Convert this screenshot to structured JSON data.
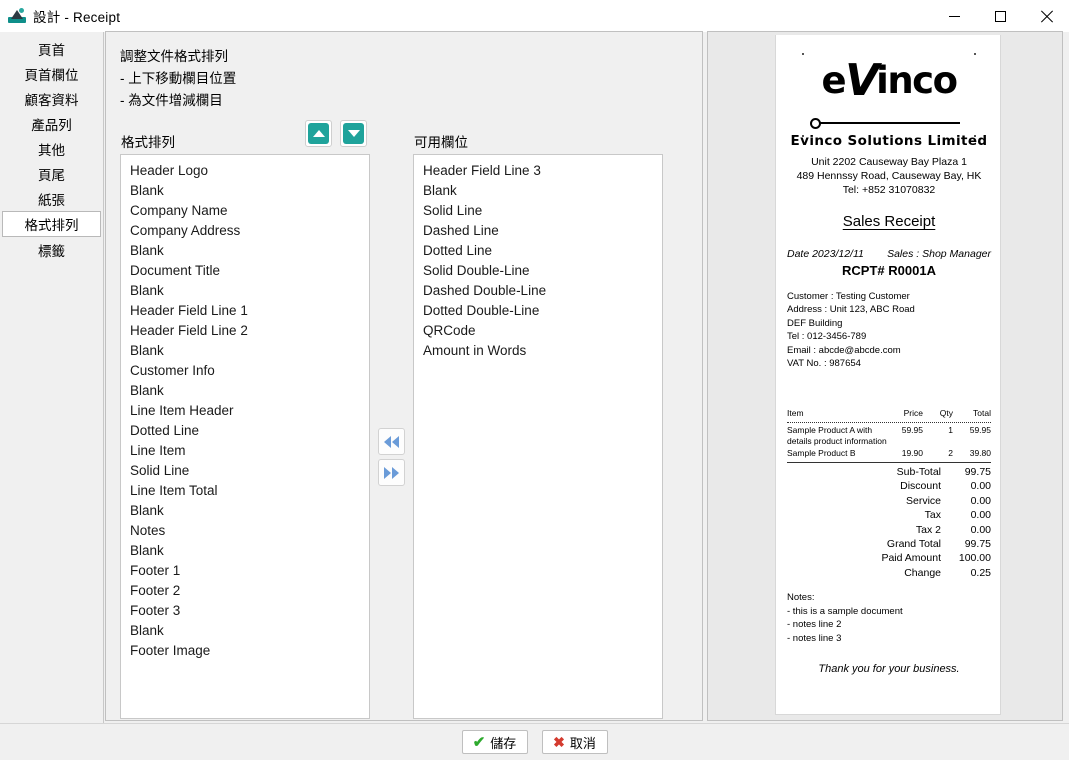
{
  "window": {
    "title": "設計 - Receipt",
    "icon": "app-logo-icon",
    "minimize_label": "—",
    "maximize_label": "□",
    "close_label": "✕"
  },
  "sidebar": {
    "items": [
      {
        "label": "頁首",
        "selected": false
      },
      {
        "label": "頁首欄位",
        "selected": false
      },
      {
        "label": "顧客資料",
        "selected": false
      },
      {
        "label": "產品列",
        "selected": false
      },
      {
        "label": "其他",
        "selected": false
      },
      {
        "label": "頁尾",
        "selected": false
      },
      {
        "label": "紙張",
        "selected": false
      },
      {
        "label": "格式排列",
        "selected": true
      },
      {
        "label": "標籤",
        "selected": false
      }
    ]
  },
  "main": {
    "instructions": [
      "調整文件格式排列",
      "- 上下移動欄目位置",
      "- 為文件增減欄目"
    ],
    "left_label": "格式排列",
    "right_label": "可用欄位",
    "sort_buttons": [
      {
        "name": "move-up-button",
        "icon": "triangle-up-icon"
      },
      {
        "name": "move-down-button",
        "icon": "triangle-down-icon"
      }
    ],
    "transfer_buttons": [
      {
        "name": "add-to-layout-button",
        "icon": "double-arrow-left-icon"
      },
      {
        "name": "remove-from-layout-button",
        "icon": "double-arrow-right-icon"
      }
    ],
    "layout_list": [
      "Header Logo",
      "Blank",
      "Company Name",
      "Company Address",
      "Blank",
      "Document Title",
      "Blank",
      "Header Field Line 1",
      "Header Field Line 2",
      "Blank",
      "Customer Info",
      "Blank",
      "Line Item Header",
      "Dotted Line",
      "Line Item",
      "Solid Line",
      "Line Item Total",
      "Blank",
      "Notes",
      "Blank",
      "Footer 1",
      "Footer 2",
      "Footer 3",
      "Blank",
      "Footer Image"
    ],
    "available_list": [
      "Header Field Line 3",
      "Blank",
      "Solid Line",
      "Dashed Line",
      "Dotted Line",
      "Solid Double-Line",
      "Dashed Double-Line",
      "Dotted Double-Line",
      "QRCode",
      "Amount in Words"
    ]
  },
  "preview": {
    "logo_pre": "e",
    "logo_v": "V",
    "logo_post": "inco",
    "company_name": "Evinco Solutions Limited",
    "address_line1": "Unit 2202 Causeway Bay Plaza 1",
    "address_line2": "489 Hennssy Road, Causeway Bay, HK",
    "address_line3": "Tel: +852 31070832",
    "doc_title": "Sales Receipt",
    "date_label": "Date 2023/12/11",
    "sales_label": "Sales : Shop Manager",
    "receipt_no": "RCPT# R0001A",
    "customer": [
      "Customer : Testing Customer",
      "Address : Unit 123, ABC Road",
      "DEF Building",
      "Tel : 012-3456-789",
      "Email : abcde@abcde.com",
      "VAT No. : 987654"
    ],
    "table": {
      "headers": [
        "Item",
        "Price",
        "Qty",
        "Total"
      ],
      "rows": [
        {
          "desc": "Sample Product A with",
          "desc2": "details product information",
          "price": "59.95",
          "qty": "1",
          "total": "59.95"
        },
        {
          "desc": "Sample Product B",
          "desc2": "",
          "price": "19.90",
          "qty": "2",
          "total": "39.80"
        }
      ]
    },
    "totals": [
      {
        "label": "Sub-Total",
        "value": "99.75"
      },
      {
        "label": "Discount",
        "value": "0.00"
      },
      {
        "label": "Service",
        "value": "0.00"
      },
      {
        "label": "Tax",
        "value": "0.00"
      },
      {
        "label": "Tax 2",
        "value": "0.00"
      },
      {
        "label": "Grand Total",
        "value": "99.75"
      },
      {
        "label": "Paid Amount",
        "value": "100.00"
      },
      {
        "label": "Change",
        "value": "0.25"
      }
    ],
    "notes": [
      "Notes:",
      "- this is a sample document",
      "- notes line 2",
      "- notes line 3"
    ],
    "thanks": "Thank you for your business."
  },
  "footer": {
    "save_label": "儲存",
    "cancel_label": "取消",
    "save_icon": "check-icon",
    "cancel_icon": "cross-icon"
  },
  "colors": {
    "accent_teal": "#1fa39b",
    "arrow_blue": "#6a9bd8",
    "check_green": "#2eaa2e",
    "cross_red": "#d43b2f",
    "panel_bg": "#f0f0f0",
    "preview_bg": "#e9e9e9"
  }
}
